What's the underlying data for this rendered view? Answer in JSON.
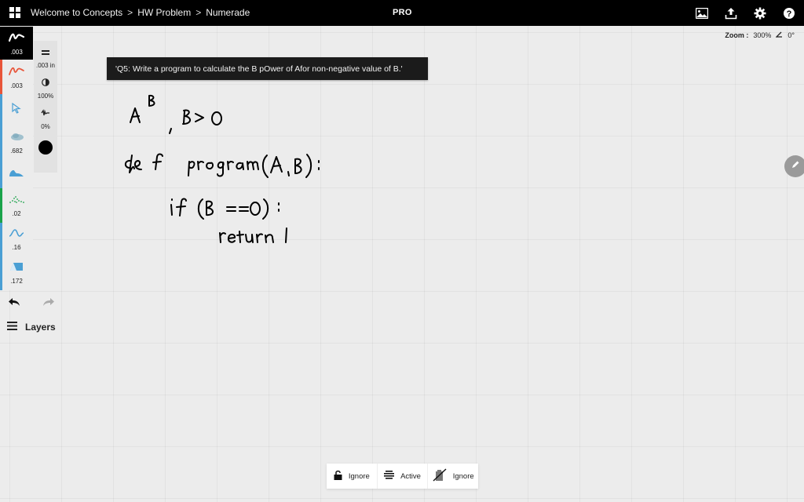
{
  "topbar": {
    "menu_icon": "grid-icon",
    "breadcrumb": [
      "Welcome to Concepts",
      "HW Problem",
      "Numerade"
    ],
    "separator": ">",
    "badge": "PRO",
    "icons": [
      "image-icon",
      "upload-icon",
      "gear-icon",
      "help-icon"
    ]
  },
  "zoom": {
    "label": "Zoom :",
    "value": "300%",
    "angle_icon": "angle-icon",
    "angle": "0°"
  },
  "toolbar": {
    "tools": [
      {
        "name": "pen",
        "icon": "pen-stroke-icon",
        "value": ".003",
        "active": true,
        "color": "#000000"
      },
      {
        "name": "pencil",
        "icon": "pencil-stroke-icon",
        "value": ".003",
        "color": "#e8553a"
      },
      {
        "name": "select",
        "icon": "select-arrow-icon",
        "value": "",
        "color": "#4a9fd4"
      },
      {
        "name": "airbrush",
        "icon": "airbrush-icon",
        "value": ".682",
        "color": "#4a9fd4"
      },
      {
        "name": "fill",
        "icon": "fill-brush-icon",
        "value": "",
        "color": "#4a9fd4"
      },
      {
        "name": "dots",
        "icon": "dots-brush-icon",
        "value": ".02",
        "color": "#1aa34a"
      },
      {
        "name": "wave",
        "icon": "wave-brush-icon",
        "value": ".16",
        "color": "#4a9fd4"
      },
      {
        "name": "eraser",
        "icon": "eraser-icon",
        "value": ".172",
        "color": "#4a9fd4"
      }
    ],
    "undo_icon": "undo-icon",
    "redo_icon": "redo-icon"
  },
  "properties": {
    "size": {
      "icon": "line-weight-icon",
      "value": ".003 in"
    },
    "opacity": {
      "icon": "opacity-icon",
      "value": "100%"
    },
    "smoothing": {
      "icon": "smoothing-icon",
      "value": "0%"
    },
    "color": {
      "icon": "color-swatch",
      "value": "#000000"
    }
  },
  "layers": {
    "icon": "layers-icon",
    "label": "Layers"
  },
  "question": {
    "text": "'Q5: Write a program to calculate the B pOwer of Afor non-negative value of B.'"
  },
  "handwriting": {
    "lines": [
      "A^B , B>0",
      "def program(A, B):",
      "if (B == 0):",
      "return 1"
    ]
  },
  "edit_fab": {
    "icon": "pencil-icon"
  },
  "bottom_bar": {
    "items": [
      {
        "icon": "unlock-icon",
        "label": "Ignore"
      },
      {
        "icon": "layers-stack-icon",
        "label": "Active"
      },
      {
        "icon": "no-layer-icon",
        "label": "Ignore"
      }
    ]
  }
}
